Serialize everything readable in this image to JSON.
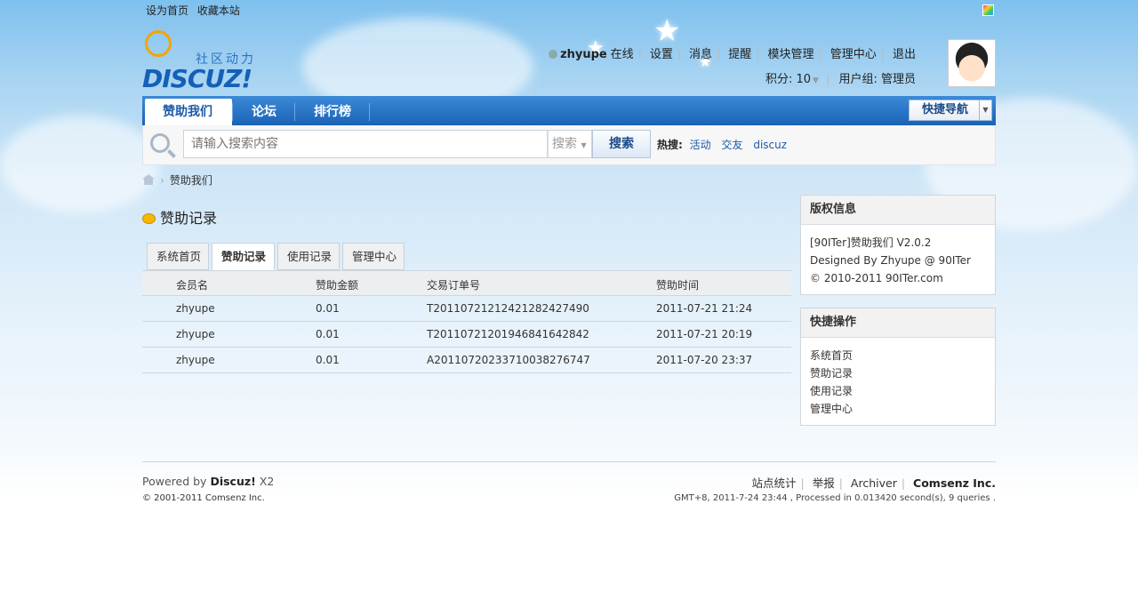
{
  "topbar": {
    "set_home": "设为首页",
    "bookmark": "收藏本站"
  },
  "logo": {
    "cn": "社区动力",
    "en": "DISCUZ!"
  },
  "user": {
    "name": "zhyupe",
    "status": "在线",
    "links": [
      "设置",
      "消息",
      "提醒",
      "模块管理",
      "管理中心",
      "退出"
    ],
    "points_label": "积分: 10",
    "group_label": "用户组: 管理员"
  },
  "nav": {
    "tabs": [
      "赞助我们",
      "论坛",
      "排行榜"
    ],
    "active": "赞助我们",
    "quicknav": "快捷导航"
  },
  "search": {
    "placeholder": "请输入搜索内容",
    "type": "搜索",
    "button": "搜索",
    "hot_label": "热搜:",
    "hot_words": [
      "活动",
      "交友",
      "discuz"
    ]
  },
  "breadcrumb": {
    "current": "赞助我们"
  },
  "page": {
    "title": "赞助记录"
  },
  "tabs": [
    "系统首页",
    "赞助记录",
    "使用记录",
    "管理中心"
  ],
  "table": {
    "headers": [
      "会员名",
      "赞助金额",
      "交易订单号",
      "赞助时间"
    ],
    "rows": [
      [
        "zhyupe",
        "0.01",
        "T201107212124212824274​90",
        "2011-07-21 21:24"
      ],
      [
        "zhyupe",
        "0.01",
        "T20110721201946841642842",
        "2011-07-21 20:19"
      ],
      [
        "zhyupe",
        "0.01",
        "A20110720233710038276747",
        "2011-07-20 23:37"
      ]
    ]
  },
  "sidebar": {
    "copyright": {
      "title": "版权信息",
      "lines": [
        "[90ITer]赞助我们 V2.0.2",
        "Designed By Zhyupe @ 90ITer",
        "© 2010-2011 90ITer.com"
      ]
    },
    "quick": {
      "title": "快捷操作",
      "links": [
        "系统首页",
        "赞助记录",
        "使用记录",
        "管理中心"
      ]
    }
  },
  "footer": {
    "powered": "Powered by",
    "product": "Discuz!",
    "version": "X2",
    "copyright": "© 2001-2011 Comsenz Inc.",
    "links": [
      "站点统计",
      "举报",
      "Archiver"
    ],
    "company": "Comsenz Inc.",
    "stats": "GMT+8, 2011-7-24 23:44 , Processed in 0.013420 second(s), 9 queries ."
  }
}
